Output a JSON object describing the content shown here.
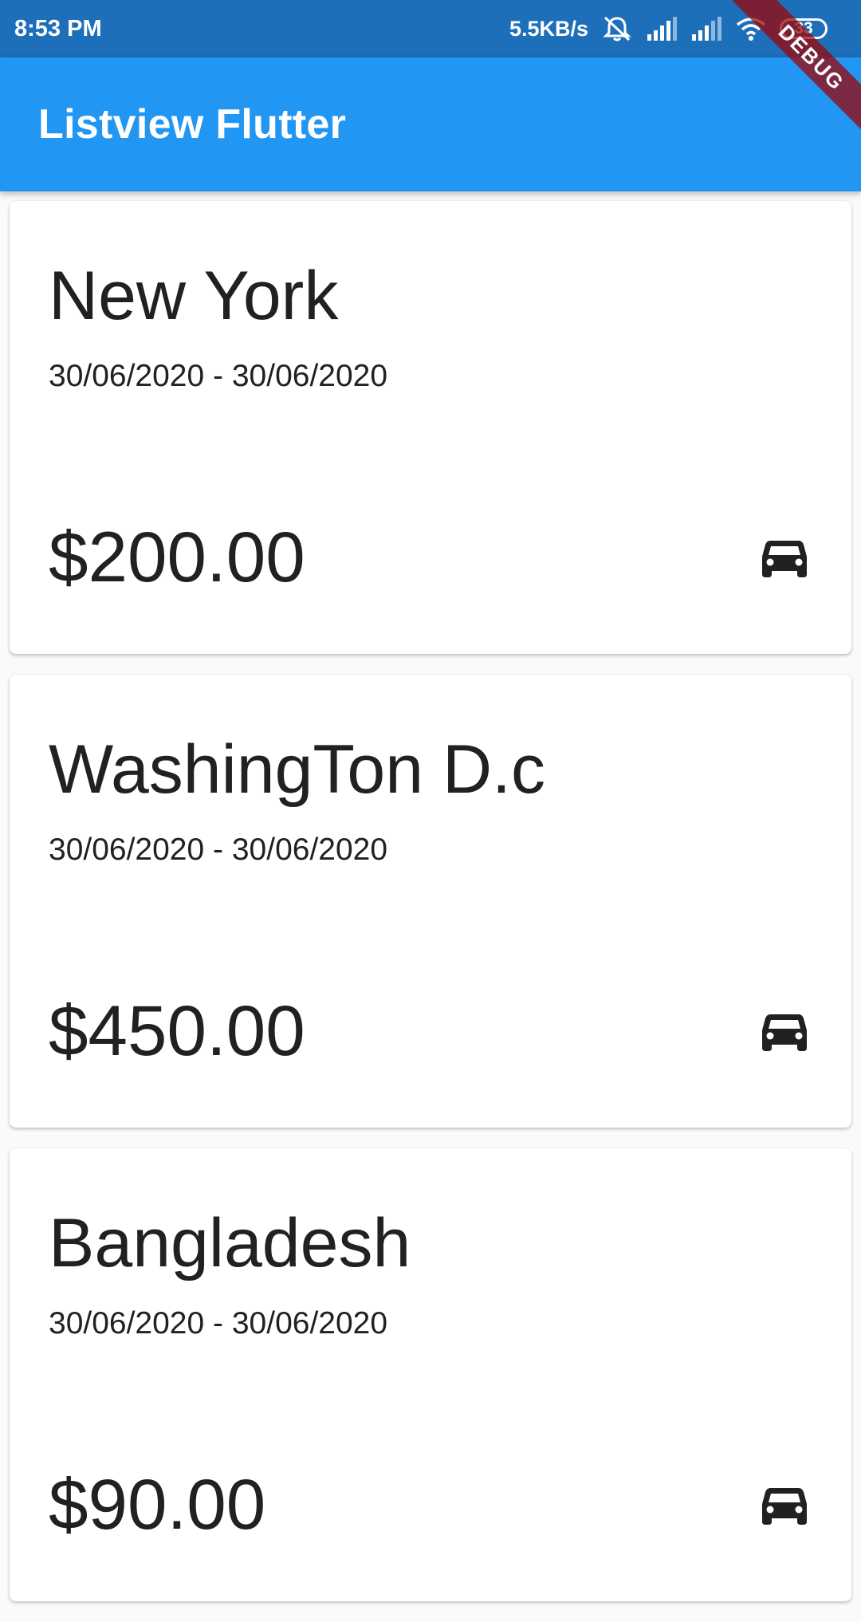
{
  "status_bar": {
    "time": "8:53 PM",
    "speed": "5.5KB/s",
    "battery": "33",
    "icons": [
      "mute-bell-icon",
      "signal-icon",
      "signal-icon",
      "wifi-icon",
      "battery-icon"
    ]
  },
  "app_bar": {
    "title": "Listview Flutter"
  },
  "debug_banner": {
    "label": "DEBUG"
  },
  "trips": [
    {
      "city": "New York",
      "dates": "30/06/2020 - 30/06/2020",
      "price": "$200.00",
      "icon": "car-icon"
    },
    {
      "city": "WashingTon D.c",
      "dates": "30/06/2020 - 30/06/2020",
      "price": "$450.00",
      "icon": "car-icon"
    },
    {
      "city": "Bangladesh",
      "dates": "30/06/2020 - 30/06/2020",
      "price": "$90.00",
      "icon": "car-icon"
    }
  ],
  "colors": {
    "status_bar": "#1d6fba",
    "app_bar": "#2196f3",
    "text": "#212121",
    "background": "#fafafa"
  }
}
